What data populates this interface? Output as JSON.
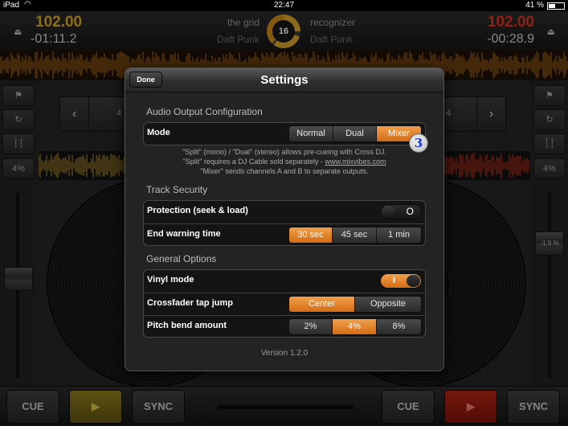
{
  "status_bar": {
    "carrier": "iPad",
    "time": "22:47",
    "battery_text": "41 %"
  },
  "deck_left": {
    "bpm": "102.00",
    "time_remaining": "-01:11.2",
    "track_title": "the grid",
    "artist": "Daft Punk",
    "pitch_percent": "4%",
    "nav_number": "4",
    "cue_label": "CUE",
    "play_label": "▶",
    "sync_label": "SYNC"
  },
  "deck_right": {
    "bpm": "102.00",
    "time_remaining": "-00:28.9",
    "track_title": "recognizer",
    "artist": "Daft Punk",
    "pitch_percent": "4%",
    "pitch_readout": "-1.9 %",
    "nav_number": "4",
    "cue_label": "CUE",
    "play_label": "▶",
    "sync_label": "SYNC"
  },
  "beat_counter": "16",
  "settings": {
    "title": "Settings",
    "done_label": "Done",
    "audio_output": {
      "heading": "Audio Output Configuration",
      "mode_label": "Mode",
      "options": [
        "Normal",
        "Dual",
        "Mixer"
      ],
      "selected": "Mixer",
      "help_line1": "\"Split\" (mono) / \"Dual\" (stereo) allows pre-cueing with Cross DJ.",
      "help_line2_prefix": "\"Split\" requires a DJ Cable sold separately - ",
      "help_link": "www.mixvibes.com",
      "help_line3": "\"Mixer\" sends channels A and B to separate outputs.",
      "step_badge": "3"
    },
    "track_security": {
      "heading": "Track Security",
      "protection_label": "Protection (seek & load)",
      "protection_on": false,
      "protection_symbol": "O",
      "end_warning_label": "End warning time",
      "end_warning_options": [
        "30 sec",
        "45 sec",
        "1 min"
      ],
      "end_warning_selected": "30 sec"
    },
    "general": {
      "heading": "General Options",
      "vinyl_label": "Vinyl mode",
      "vinyl_on": true,
      "vinyl_symbol": "I",
      "crossfader_label": "Crossfader tap jump",
      "crossfader_options": [
        "Center",
        "Opposite"
      ],
      "crossfader_selected": "Center",
      "pitch_bend_label": "Pitch bend amount",
      "pitch_bend_options": [
        "2%",
        "4%",
        "8%"
      ],
      "pitch_bend_selected": "4%"
    },
    "version": "Version 1.2.0"
  },
  "colors": {
    "accent_orange": "#e07f24",
    "deck_left_yellow": "#d9a92a",
    "deck_right_red": "#e4321e"
  }
}
